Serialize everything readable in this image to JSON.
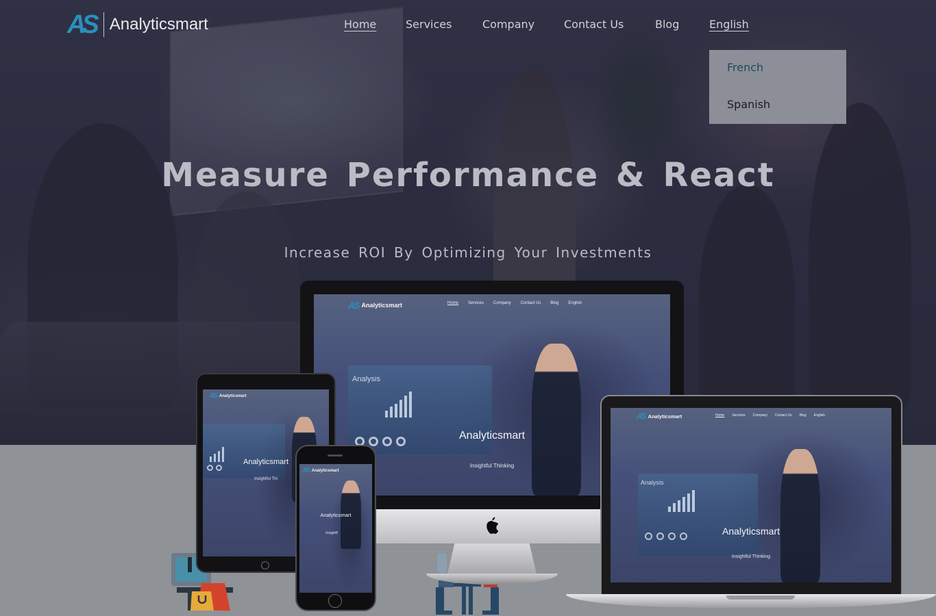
{
  "brand": {
    "logo_mark": "AS",
    "name": "Analyticsmart"
  },
  "nav": {
    "items": [
      {
        "label": "Home",
        "active": true
      },
      {
        "label": "Services",
        "active": false
      },
      {
        "label": "Company",
        "active": false
      },
      {
        "label": "Contact Us",
        "active": false
      },
      {
        "label": "Blog",
        "active": false
      },
      {
        "label": "English",
        "active": false
      }
    ]
  },
  "language_menu": {
    "options": [
      "French",
      "Spanish"
    ]
  },
  "hero": {
    "title": "Measure Performance & React",
    "subtitle": "Increase ROI By Optimizing Your Investments"
  },
  "mockup": {
    "brand": "Analyticsmart",
    "nav": [
      "Home",
      "Services",
      "Company",
      "Contact Us",
      "Blog",
      "English"
    ],
    "title": "Analyticsmart",
    "subtitle": "Insightful Thinking",
    "subtitle_tablet": "Insightful Thi",
    "subtitle_phone": "Insightf",
    "screen_chart_title": "Analysis"
  },
  "colors": {
    "accent": "#2a8fbd",
    "dropdown_bg": "#8c8f97"
  },
  "icons": {
    "apple": "apple-logo-icon",
    "cart": "shopping-cart-icon",
    "bag": "shopping-bag-icon"
  }
}
